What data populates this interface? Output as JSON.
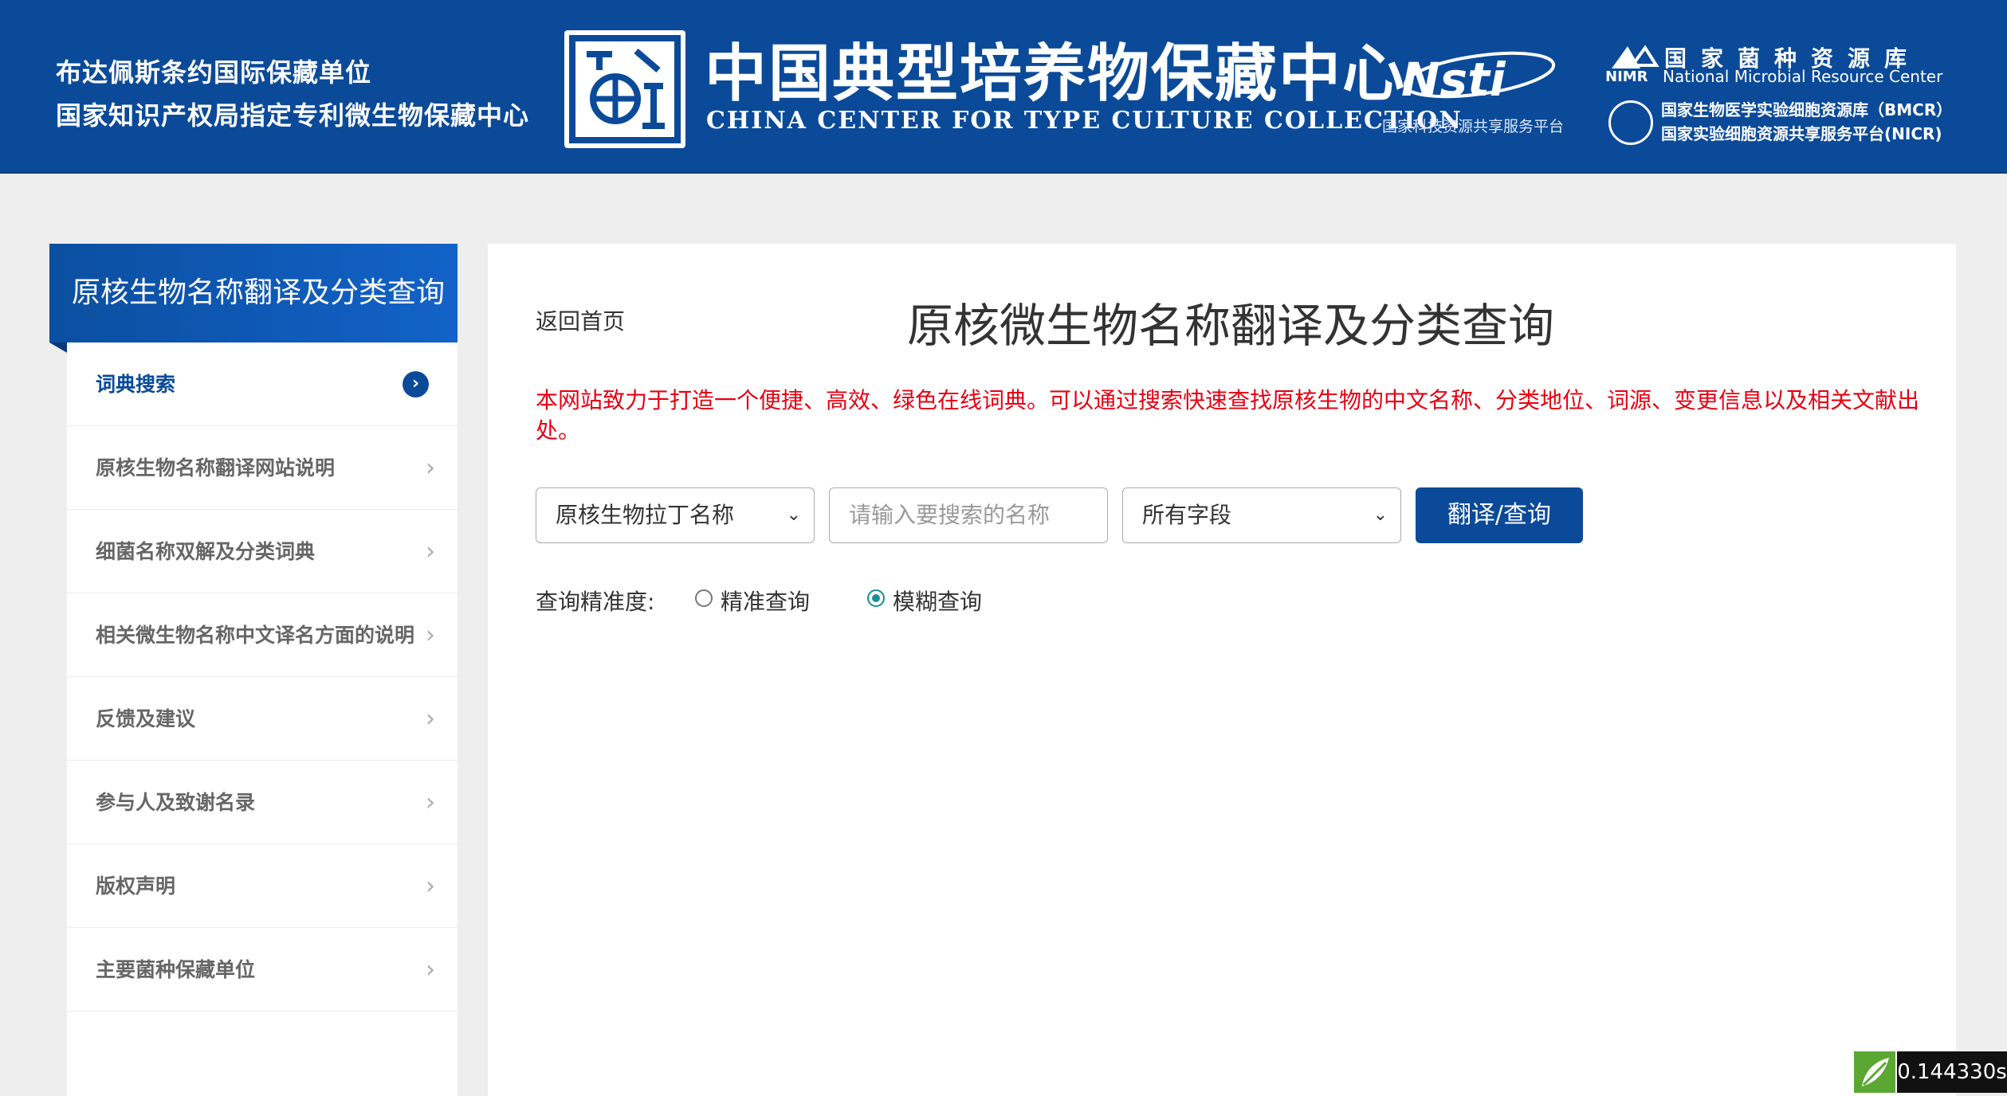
{
  "header": {
    "left_line1": "布达佩斯条约国际保藏单位",
    "left_line2": "国家知识产权局指定专利微生物保藏中心",
    "center_cn": "中国典型培养物保藏中心",
    "center_en": "CHINA CENTER FOR TYPE CULTURE COLLECTION",
    "nsti_logo_text": "Nsti",
    "nsti_caption": "国家科技资源共享服务平台",
    "nmrc_cn": "国家菌种资源库",
    "nmrc_abbr": "NIMR",
    "nmrc_en": "National Microbial Resource Center",
    "bmcr": "国家生物医学实验细胞资源库（BMCR）",
    "nicr": "国家实验细胞资源共享服务平台(NICR)"
  },
  "sidebar": {
    "title": "原核生物名称翻译及分类查询",
    "items": [
      {
        "label": "词典搜索",
        "active": true
      },
      {
        "label": "原核生物名称翻译网站说明"
      },
      {
        "label": "细菌名称双解及分类词典"
      },
      {
        "label": "相关微生物名称中文译名方面的说明"
      },
      {
        "label": "反馈及建议"
      },
      {
        "label": "参与人及致谢名录"
      },
      {
        "label": "版权声明"
      },
      {
        "label": "主要菌种保藏单位"
      }
    ],
    "arrow_glyph": "›",
    "active_icon_glyph": "›"
  },
  "main": {
    "back_link": "返回首页",
    "title": "原核微生物名称翻译及分类查询",
    "intro": "本网站致力于打造一个便捷、高效、绿色在线词典。可以通过搜索快速查找原核生物的中文名称、分类地位、词源、变更信息以及相关文献出处。",
    "select1_value": "原核生物拉丁名称",
    "search_placeholder": "请输入要搜索的名称",
    "select2_value": "所有字段",
    "search_button": "翻译/查询",
    "precision_label": "查询精准度:",
    "option_exact": "精准查询",
    "option_fuzzy": "模糊查询",
    "selected_option": "模糊查询",
    "caret_glyph": "⌄"
  },
  "timer": {
    "value": "0.144330s"
  },
  "colors": {
    "brand": "#0a4a99",
    "notice": "#e60012",
    "radio_checked": "#1a8f8f"
  }
}
